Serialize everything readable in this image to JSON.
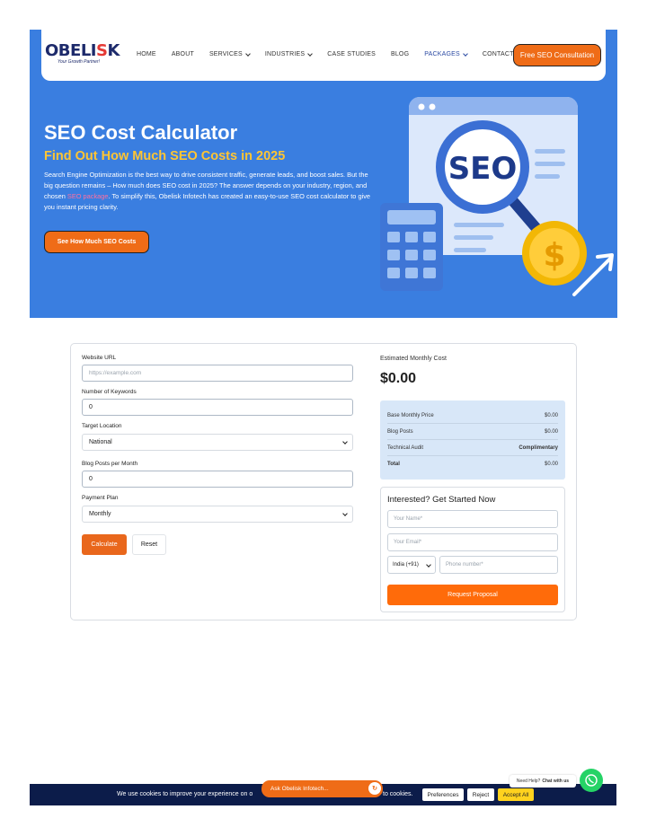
{
  "brand": {
    "logo_text_a": "OBELI",
    "logo_text_b": "S",
    "logo_text_c": "K",
    "tagline": "Your Growth Partner!"
  },
  "nav": {
    "items": [
      {
        "label": "HOME",
        "dropdown": false
      },
      {
        "label": "ABOUT",
        "dropdown": false
      },
      {
        "label": "SERVICES",
        "dropdown": true
      },
      {
        "label": "INDUSTRIES",
        "dropdown": true
      },
      {
        "label": "CASE STUDIES",
        "dropdown": false
      },
      {
        "label": "BLOG",
        "dropdown": false
      },
      {
        "label": "PACKAGES",
        "dropdown": true,
        "active": true
      },
      {
        "label": "CONTACT US",
        "dropdown": false
      }
    ],
    "cta": "Free SEO Consultation"
  },
  "hero": {
    "title": "SEO Cost Calculator",
    "subtitle": "Find Out How Much SEO Costs in 2025",
    "desc_a": "Search Engine Optimization is the best way to drive consistent traffic, generate leads, and boost sales. But the big question remains – How much does SEO cost in 2025? The answer depends on your industry, region, and chosen ",
    "desc_link": "SEO package",
    "desc_b": ". To simplify this, Obelisk Infotech has created an easy-to-use SEO cost calculator to give you instant pricing clarity.",
    "button": "See How Much SEO Costs",
    "illustration_text": "SEO"
  },
  "calculator": {
    "website_label": "Website URL",
    "website_placeholder": "https://example.com",
    "keywords_label": "Number of Keywords",
    "keywords_value": "0",
    "location_label": "Target Location",
    "location_value": "National",
    "blog_label": "Blog Posts per Month",
    "blog_value": "0",
    "plan_label": "Payment Plan",
    "plan_value": "Monthly",
    "calculate": "Calculate",
    "reset": "Reset",
    "estimate_label": "Estimated Monthly Cost",
    "estimate_value": "$0.00",
    "breakdown": [
      {
        "label": "Base Monthly Price",
        "value": "$0.00",
        "bold_value": false,
        "bold_label": false
      },
      {
        "label": "Blog Posts",
        "value": "$0.00",
        "bold_value": false,
        "bold_label": false
      },
      {
        "label": "Technical Audit",
        "value": "Complimentary",
        "bold_value": true,
        "bold_label": false
      },
      {
        "label": "Total",
        "value": "$0.00",
        "bold_value": false,
        "bold_label": true
      }
    ]
  },
  "lead_form": {
    "title": "Interested? Get Started Now",
    "name_placeholder": "Your Name*",
    "email_placeholder": "Your Email*",
    "country": "India (+91)",
    "phone_placeholder": "Phone number*",
    "submit": "Request Proposal"
  },
  "cookie": {
    "text_a": "We use cookies to improve your experience on o",
    "text_b": "to cookies.",
    "preferences": "Preferences",
    "reject": "Reject",
    "accept": "Accept All"
  },
  "chat": {
    "ask_label": "Ask Obelisk Infotech...",
    "help_a": "Need Help?",
    "help_b": "Chat with us"
  },
  "colors": {
    "hero_bg": "#3a7ee0",
    "accent": "#ef6c17",
    "subtitle": "#ffc533",
    "cookie_bg": "#0c1c4a"
  }
}
